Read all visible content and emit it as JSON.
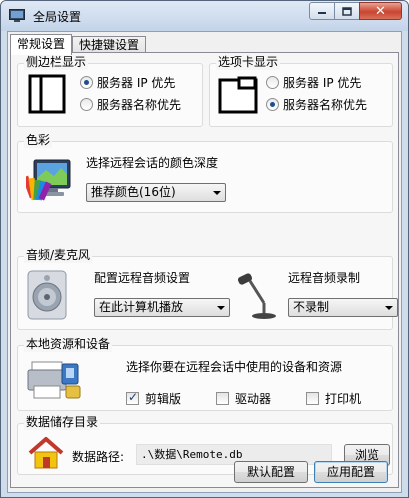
{
  "window": {
    "title": "全局设置",
    "close_symbol": "✕"
  },
  "tabs": [
    {
      "label": "常规设置",
      "active": true
    },
    {
      "label": "快捷键设置",
      "active": false
    }
  ],
  "sidebar_display": {
    "title": "侧边栏显示",
    "options": [
      {
        "label": "服务器 IP 优先",
        "selected": true
      },
      {
        "label": "服务器名称优先",
        "selected": false
      }
    ]
  },
  "tab_display": {
    "title": "选项卡显示",
    "options": [
      {
        "label": "服务器 IP 优先",
        "selected": false
      },
      {
        "label": "服务器名称优先",
        "selected": true
      }
    ]
  },
  "color": {
    "title": "色彩",
    "description": "选择远程会话的颜色深度",
    "depth_selected": "推荐颜色(16位)"
  },
  "audio": {
    "title": "音频/麦克风",
    "playback_label": "配置远程音频设置",
    "playback_selected": "在此计算机播放",
    "record_label": "远程音频录制",
    "record_selected": "不录制"
  },
  "local_resources": {
    "title": "本地资源和设备",
    "description": "选择你要在远程会话中使用的设备和资源",
    "devices": [
      {
        "label": "剪辑版",
        "checked": true
      },
      {
        "label": "驱动器",
        "checked": false
      },
      {
        "label": "打印机",
        "checked": false
      }
    ]
  },
  "storage": {
    "title": "数据储存目录",
    "path_label": "数据路径:",
    "path_value": ".\\数据\\Remote.db",
    "browse_label": "浏览"
  },
  "footer": {
    "default_label": "默认配置",
    "apply_label": "应用配置"
  }
}
